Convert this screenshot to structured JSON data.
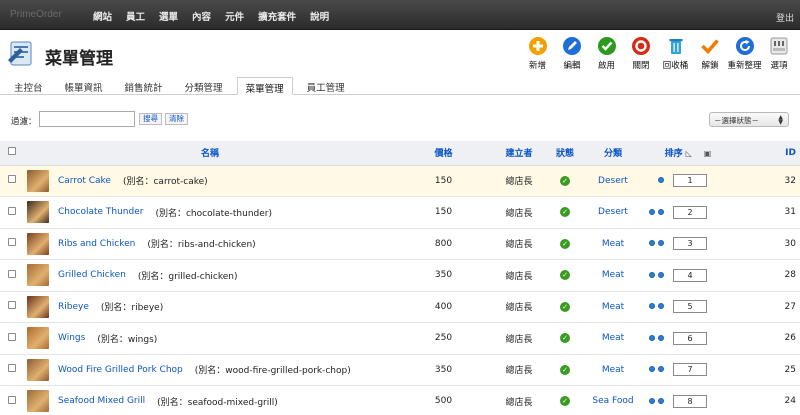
{
  "topbar": {
    "brand": "PrimeOrder",
    "nav": [
      "網站",
      "員工",
      "選單",
      "內容",
      "元件",
      "擴充套件",
      "說明"
    ],
    "logout": "登出"
  },
  "header": {
    "title": "菜單管理",
    "toolbar": [
      {
        "name": "new",
        "label": "新增",
        "icon": "plus-circle-icon",
        "color": "#f2a100"
      },
      {
        "name": "edit",
        "label": "編輯",
        "icon": "pencil-icon",
        "color": "#1e6ed8"
      },
      {
        "name": "enable",
        "label": "啟用",
        "icon": "check-circle-icon",
        "color": "#2c9a1e"
      },
      {
        "name": "disable",
        "label": "關閉",
        "icon": "stop-circle-icon",
        "color": "#d62b14"
      },
      {
        "name": "trash",
        "label": "回收桶",
        "icon": "trash-icon",
        "color": "#2fa3d6"
      },
      {
        "name": "unlock",
        "label": "解鎖",
        "icon": "check-mark-icon",
        "color": "#f07c00"
      },
      {
        "name": "reorder",
        "label": "重新整理",
        "icon": "refresh-icon",
        "color": "#1e6ed8"
      },
      {
        "name": "options",
        "label": "選項",
        "icon": "options-icon",
        "color": "#666666"
      }
    ]
  },
  "tabs": [
    {
      "label": "主控台",
      "active": false
    },
    {
      "label": "帳單資訊",
      "active": false
    },
    {
      "label": "銷售統計",
      "active": false
    },
    {
      "label": "分類管理",
      "active": false
    },
    {
      "label": "菜單管理",
      "active": true
    },
    {
      "label": "員工管理",
      "active": false
    }
  ],
  "filter": {
    "label": "過濾：",
    "value": "",
    "search": "搜尋",
    "clear": "清除",
    "status_select": "－選擇狀態－"
  },
  "table": {
    "columns": {
      "name": "名稱",
      "price": "價格",
      "author": "建立者",
      "status": "狀態",
      "category": "分類",
      "order": "排序",
      "id": "ID"
    },
    "rows": [
      {
        "name": "Carrot Cake",
        "alias": "(別名：carrot-cake)",
        "price": "150",
        "author": "總店長",
        "category": "Desert",
        "order": "1",
        "id": "32",
        "up": false,
        "down": true,
        "thumb": "#8a5a2b",
        "highlight": true
      },
      {
        "name": "Chocolate Thunder",
        "alias": "(別名：chocolate-thunder)",
        "price": "150",
        "author": "總店長",
        "category": "Desert",
        "order": "2",
        "id": "31",
        "up": true,
        "down": true,
        "thumb": "#3d2a1c",
        "highlight": false
      },
      {
        "name": "Ribs and Chicken",
        "alias": "(別名：ribs-and-chicken)",
        "price": "800",
        "author": "總店長",
        "category": "Meat",
        "order": "3",
        "id": "30",
        "up": true,
        "down": true,
        "thumb": "#7a3e1e",
        "highlight": false
      },
      {
        "name": "Grilled Chicken",
        "alias": "(別名：grilled-chicken)",
        "price": "350",
        "author": "總店長",
        "category": "Meat",
        "order": "4",
        "id": "28",
        "up": true,
        "down": true,
        "thumb": "#a66a2e",
        "highlight": false
      },
      {
        "name": "Ribeye",
        "alias": "(別名：ribeye)",
        "price": "400",
        "author": "總店長",
        "category": "Meat",
        "order": "5",
        "id": "27",
        "up": true,
        "down": true,
        "thumb": "#6b2f18",
        "highlight": false
      },
      {
        "name": "Wings",
        "alias": "(別名：wings)",
        "price": "250",
        "author": "總店長",
        "category": "Meat",
        "order": "6",
        "id": "26",
        "up": true,
        "down": true,
        "thumb": "#b06a2a",
        "highlight": false
      },
      {
        "name": "Wood Fire Grilled Pork Chop",
        "alias": "(別名：wood-fire-grilled-pork-chop)",
        "price": "350",
        "author": "總店長",
        "category": "Meat",
        "order": "7",
        "id": "25",
        "up": true,
        "down": true,
        "thumb": "#8c5a32",
        "highlight": false
      },
      {
        "name": "Seafood Mixed Grill",
        "alias": "(別名：seafood-mixed-grill)",
        "price": "500",
        "author": "總店長",
        "category": "Sea Food",
        "order": "8",
        "id": "24",
        "up": true,
        "down": true,
        "thumb": "#9a6a3a",
        "highlight": false
      }
    ]
  }
}
